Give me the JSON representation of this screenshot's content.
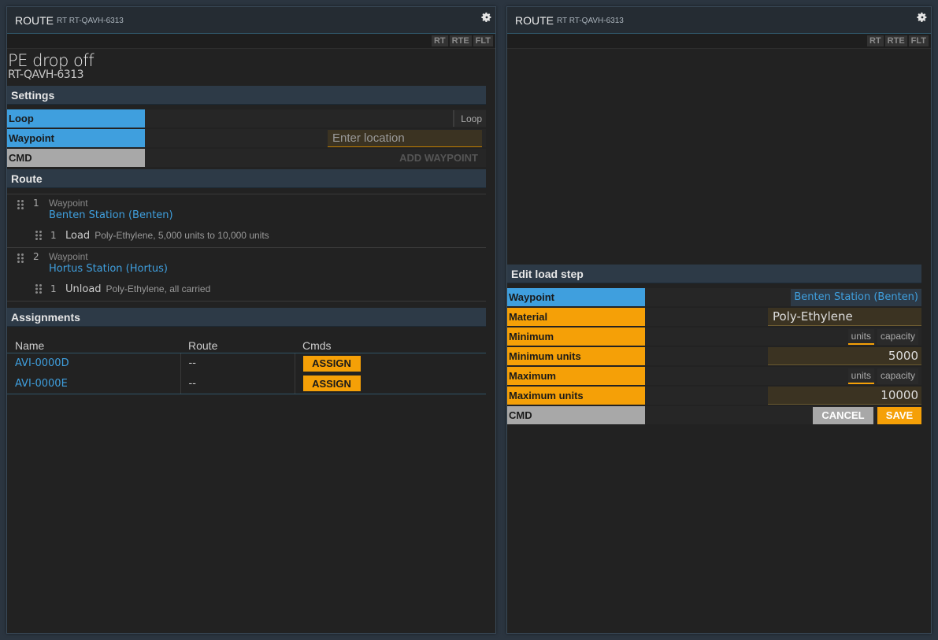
{
  "left": {
    "header": {
      "title": "ROUTE",
      "subtitle": "RT RT-QAVH-6313"
    },
    "tabs": [
      "RT",
      "RTE",
      "FLT"
    ],
    "route_name": "PE drop off",
    "route_id": "RT-QAVH-6313",
    "settings": {
      "section_label": "Settings",
      "loop_label": "Loop",
      "loop_toggle": "Loop",
      "waypoint_label": "Waypoint",
      "waypoint_placeholder": "Enter location",
      "cmd_label": "CMD",
      "add_waypoint": "ADD WAYPOINT"
    },
    "route": {
      "section_label": "Route",
      "waypoints": [
        {
          "index": "1",
          "kind": "Waypoint",
          "station": "Benten Station (Benten)",
          "step": {
            "index": "1",
            "action": "Load",
            "detail": "Poly-Ethylene, 5,000 units to 10,000 units"
          }
        },
        {
          "index": "2",
          "kind": "Waypoint",
          "station": "Hortus Station (Hortus)",
          "step": {
            "index": "1",
            "action": "Unload",
            "detail": "Poly-Ethylene, all carried"
          }
        }
      ]
    },
    "assignments": {
      "section_label": "Assignments",
      "columns": [
        "Name",
        "Route",
        "Cmds"
      ],
      "rows": [
        {
          "name": "AVI-0000D",
          "route": "--",
          "cmd": "ASSIGN"
        },
        {
          "name": "AVI-0000E",
          "route": "--",
          "cmd": "ASSIGN"
        }
      ]
    }
  },
  "right": {
    "header": {
      "title": "ROUTE",
      "subtitle": "RT RT-QAVH-6313"
    },
    "tabs": [
      "RT",
      "RTE",
      "FLT"
    ],
    "edit": {
      "section_label": "Edit load step",
      "waypoint_label": "Waypoint",
      "waypoint_value": "Benten Station (Benten)",
      "material_label": "Material",
      "material_value": "Poly-Ethylene",
      "minimum_label": "Minimum",
      "minimum_units_label": "Minimum units",
      "minimum_units_value": "5000",
      "maximum_label": "Maximum",
      "maximum_units_label": "Maximum units",
      "maximum_units_value": "10000",
      "opt_units": "units",
      "opt_capacity": "capacity",
      "cmd_label": "CMD",
      "cancel": "CANCEL",
      "save": "SAVE"
    }
  },
  "colors": {
    "accent_blue": "#3f9fde",
    "accent_orange": "#f5a007",
    "cmd_gray": "#a8a8a8"
  }
}
